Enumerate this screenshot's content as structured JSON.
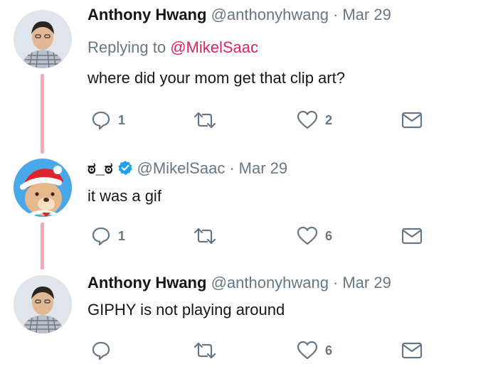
{
  "tweets": [
    {
      "name": "Anthony Hwang",
      "handle": "@anthonyhwang",
      "separator": "·",
      "date": "Mar 29",
      "replying_prefix": "Replying to",
      "replying_to": "@MikelSaac",
      "text": "where did your mom get that clip art?",
      "reply_count": "1",
      "retweet_count": "",
      "like_count": "2"
    },
    {
      "name": "ಠ_ಠ",
      "verified": true,
      "handle": "@MikelSaac",
      "separator": "·",
      "date": "Mar 29",
      "text": "it was a gif",
      "reply_count": "1",
      "retweet_count": "",
      "like_count": "6"
    },
    {
      "name": "Anthony Hwang",
      "handle": "@anthonyhwang",
      "separator": "·",
      "date": "Mar 29",
      "text": "GIPHY is not playing around",
      "reply_count": "",
      "retweet_count": "",
      "like_count": "6"
    }
  ],
  "icons": {
    "reply": "reply-icon",
    "retweet": "retweet-icon",
    "like": "heart-icon",
    "dm": "envelope-icon",
    "verified": "verified-badge-icon"
  },
  "colors": {
    "thread_line": "#f4a9b8",
    "mention": "#e0245e",
    "muted": "#657786",
    "verified": "#1da1f2"
  }
}
